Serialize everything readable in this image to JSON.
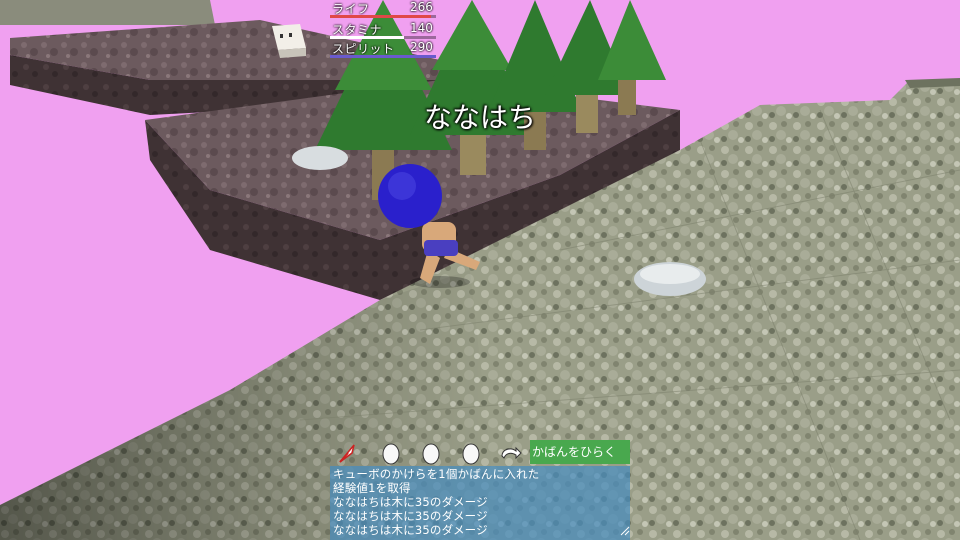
{
  "hud": {
    "stats": [
      {
        "label": "ライフ",
        "value": "266",
        "color": "#e04848",
        "fill": 0.95
      },
      {
        "label": "スタミナ",
        "value": "140",
        "color": "#ffffff",
        "fill": 0.7
      },
      {
        "label": "スピリット",
        "value": "290",
        "color": "#6a5acd",
        "fill": 1.0
      }
    ]
  },
  "player": {
    "name": "ななはち"
  },
  "toolbar": {
    "slots": [
      {
        "icon": "feather-pen-icon"
      },
      {
        "icon": "egg-icon"
      },
      {
        "icon": "egg-icon"
      },
      {
        "icon": "egg-icon"
      },
      {
        "icon": "swap-arrow-icon"
      }
    ],
    "bag_button_label": "かばんをひらく"
  },
  "log": {
    "lines": [
      "キューボのかけらを1個かばんに入れた",
      "経験値1を取得",
      "ななはちは木に35のダメージ",
      "ななはちは木に35のダメージ",
      "ななはちは木に35のダメージ"
    ]
  },
  "colors": {
    "sky": "#f0a0f0",
    "log_bg": "#468cbe",
    "bag_button": "#49a84e"
  }
}
